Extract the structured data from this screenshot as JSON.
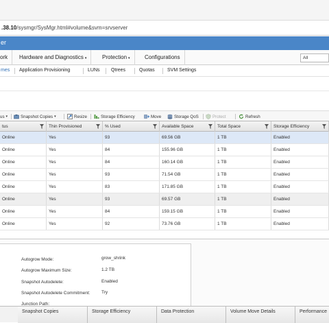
{
  "browser": {
    "address_host_fragment": ".38.10",
    "address_path": "/sysmgr/SysMgr.html#volume&svm=srvserver"
  },
  "app_header": {
    "title_fragment": "er"
  },
  "main_menu": {
    "items": [
      {
        "label": "ork"
      },
      {
        "label": "Hardware and Diagnostics",
        "caret": "▾"
      },
      {
        "label": "Protection",
        "caret": "▾"
      },
      {
        "label": "Configurations"
      }
    ],
    "search_scope": "All"
  },
  "sub_tabs": {
    "items": [
      {
        "label": "mes",
        "active": true
      },
      {
        "label": "Application Provisioning"
      },
      {
        "label": "LUNs"
      },
      {
        "label": "Qtrees"
      },
      {
        "label": "Quotas"
      },
      {
        "label": "SVM Settings"
      }
    ]
  },
  "toolbar": {
    "items": [
      {
        "label": "us",
        "caret": "▾",
        "icon": "status-icon"
      },
      {
        "label": "Snapshot Copies",
        "caret": "▾",
        "icon": "snapshot-icon"
      },
      {
        "label": "Resize",
        "icon": "resize-icon"
      },
      {
        "label": "Storage Efficiency",
        "icon": "storage-efficiency-icon"
      },
      {
        "label": "Move",
        "icon": "move-icon"
      },
      {
        "label": "Storage QoS",
        "icon": "storage-qos-icon"
      },
      {
        "label": "Protect",
        "icon": "protect-icon",
        "disabled": true
      },
      {
        "label": "Refresh",
        "icon": "refresh-icon"
      }
    ]
  },
  "table": {
    "columns": [
      "tus",
      "Thin Provisioned",
      "% Used",
      "Available Space",
      "Total Space",
      "Storage Efficiency"
    ],
    "rows": [
      [
        "Online",
        "Yes",
        "93",
        "69.56 GB",
        "1 TB",
        "Enabled"
      ],
      [
        "Online",
        "Yes",
        "84",
        "155.96 GB",
        "1 TB",
        "Enabled"
      ],
      [
        "Online",
        "Yes",
        "84",
        "160.14 GB",
        "1 TB",
        "Enabled"
      ],
      [
        "Online",
        "Yes",
        "93",
        "71.54 GB",
        "1 TB",
        "Enabled"
      ],
      [
        "Online",
        "Yes",
        "83",
        "171.85 GB",
        "1 TB",
        "Enabled"
      ],
      [
        "Online",
        "Yes",
        "93",
        "69.57 GB",
        "1 TB",
        "Enabled"
      ],
      [
        "Online",
        "Yes",
        "84",
        "159.15 GB",
        "1 TB",
        "Enabled"
      ],
      [
        "Online",
        "Yes",
        "92",
        "73.76 GB",
        "1 TB",
        "Enabled"
      ]
    ],
    "selected_row": 0,
    "highlighted_row": 5
  },
  "details": {
    "fields": [
      {
        "label": "Autogrow Mode:",
        "value": "grow_shrink"
      },
      {
        "label": "Autogrow Maximum Size:",
        "value": "1.2 TB"
      },
      {
        "label": "Snapshot Autodelete:",
        "value": "Enabled"
      },
      {
        "label": "Snapshot Autodelete Commitment:",
        "value": "Try"
      },
      {
        "label": "Junction Path:",
        "value": ""
      }
    ]
  },
  "bottom_tabs": {
    "items": [
      "Snapshot Copies",
      "Storage Efficiency",
      "Data Protection",
      "Volume Move Details",
      "Performance"
    ]
  },
  "colors": {
    "header_blue": "#4a86c8",
    "selected_row": "#dde8f7",
    "active_tab_text": "#2f6eb5"
  }
}
